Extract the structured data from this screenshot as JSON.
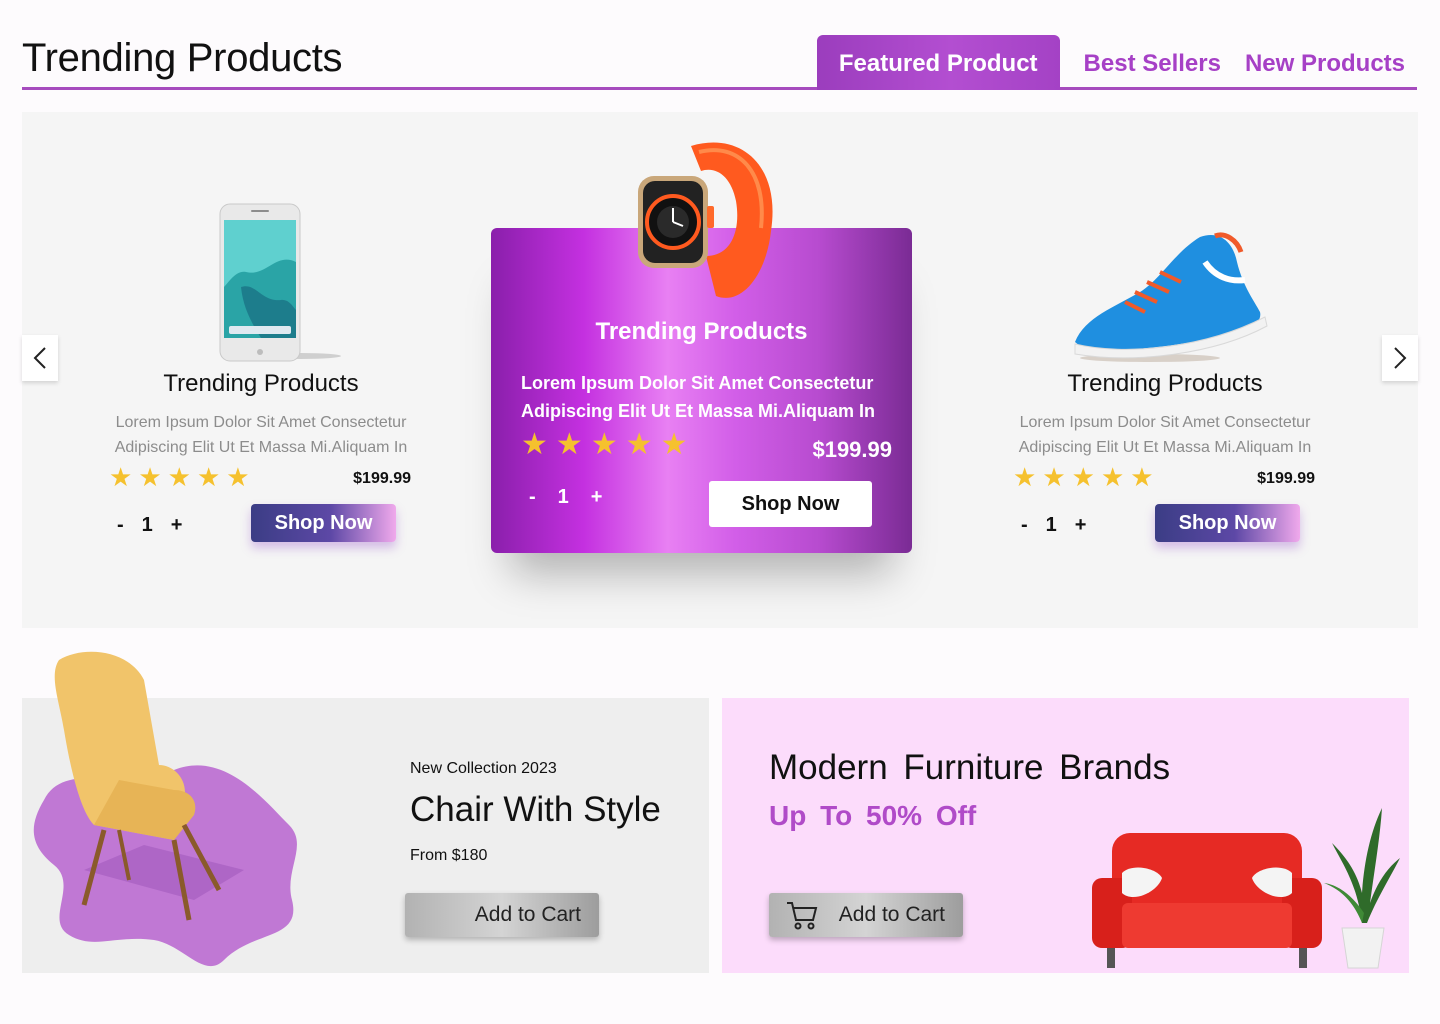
{
  "header": {
    "title": "Trending Products",
    "tabs": [
      "Featured Product",
      "Best Sellers",
      "New Products"
    ]
  },
  "carousel": {
    "cards": [
      {
        "name": "Trending Products",
        "description_line1": "Lorem Ipsum Dolor Sit Amet Consectetur",
        "description_line2": "Adipiscing Elit Ut Et Massa Mi.Aliquam In",
        "rating": 5,
        "price": "$199.99",
        "qty_minus": "-",
        "qty": "1",
        "qty_plus": "+",
        "button": "Shop Now",
        "image": "phone"
      },
      {
        "name": "Trending Products",
        "description_line1": "Lorem Ipsum Dolor Sit Amet Consectetur",
        "description_line2": "Adipiscing Elit Ut Et Massa Mi.Aliquam In",
        "rating": 5,
        "price": "$199.99",
        "qty_minus": "-",
        "qty": "1",
        "qty_plus": "+",
        "button": "Shop Now",
        "image": "smartwatch"
      },
      {
        "name": "Trending Products",
        "description_line1": "Lorem Ipsum Dolor Sit Amet Consectetur",
        "description_line2": "Adipiscing Elit Ut Et Massa Mi.Aliquam In",
        "rating": 5,
        "price": "$199.99",
        "qty_minus": "-",
        "qty": "1",
        "qty_plus": "+",
        "button": "Shop Now",
        "image": "sneaker"
      }
    ],
    "star": "★"
  },
  "banners": {
    "chair": {
      "label": "New Collection 2023",
      "title": "Chair With Style",
      "price": "From  $180",
      "button": "Add to Cart"
    },
    "furniture": {
      "title": "Modern  Furniture  Brands",
      "offer": "Up To  50% Off",
      "button": "Add to Cart"
    }
  },
  "colors": {
    "accent": "#a64bbe",
    "tab_text": "#a640c6",
    "star": "#f5c12e",
    "chair_banner_bg": "#eeeeee",
    "furniture_banner_bg": "#fcdcfb"
  }
}
